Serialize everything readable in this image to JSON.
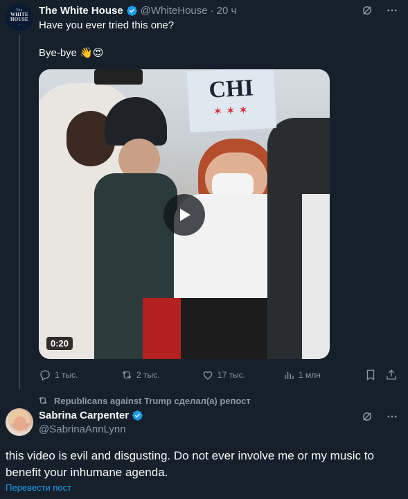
{
  "tweet1": {
    "avatar_text": {
      "the": "The",
      "line1": "WHITE",
      "line2": "HOUSE"
    },
    "author_name": "The White House",
    "handle": "@WhiteHouse",
    "separator": "·",
    "time": "20 ч",
    "text_line1": "Have you ever tried this one?",
    "text_line2": "Bye-bye 👋😍",
    "media": {
      "duration": "0:20",
      "sign_text": "CHI"
    },
    "actions": {
      "replies": "1 тыс.",
      "reposts": "2 тыс.",
      "likes": "17 тыс.",
      "views": "1 млн"
    }
  },
  "tweet2": {
    "repost_label": "Republicans against Trump сделал(а) репост",
    "author_name": "Sabrina Carpenter",
    "handle": "@SabrinaAnnLynn",
    "text": "this video is evil and disgusting. Do not ever involve me or my music to benefit your inhumane agenda.",
    "translate_label": "Перевести пост"
  },
  "colors": {
    "background": "#15202b",
    "primary_text": "#f7f9f9",
    "secondary_text": "#8b98a5",
    "accent": "#1d9bf0",
    "verified": "#1d9bf0"
  }
}
